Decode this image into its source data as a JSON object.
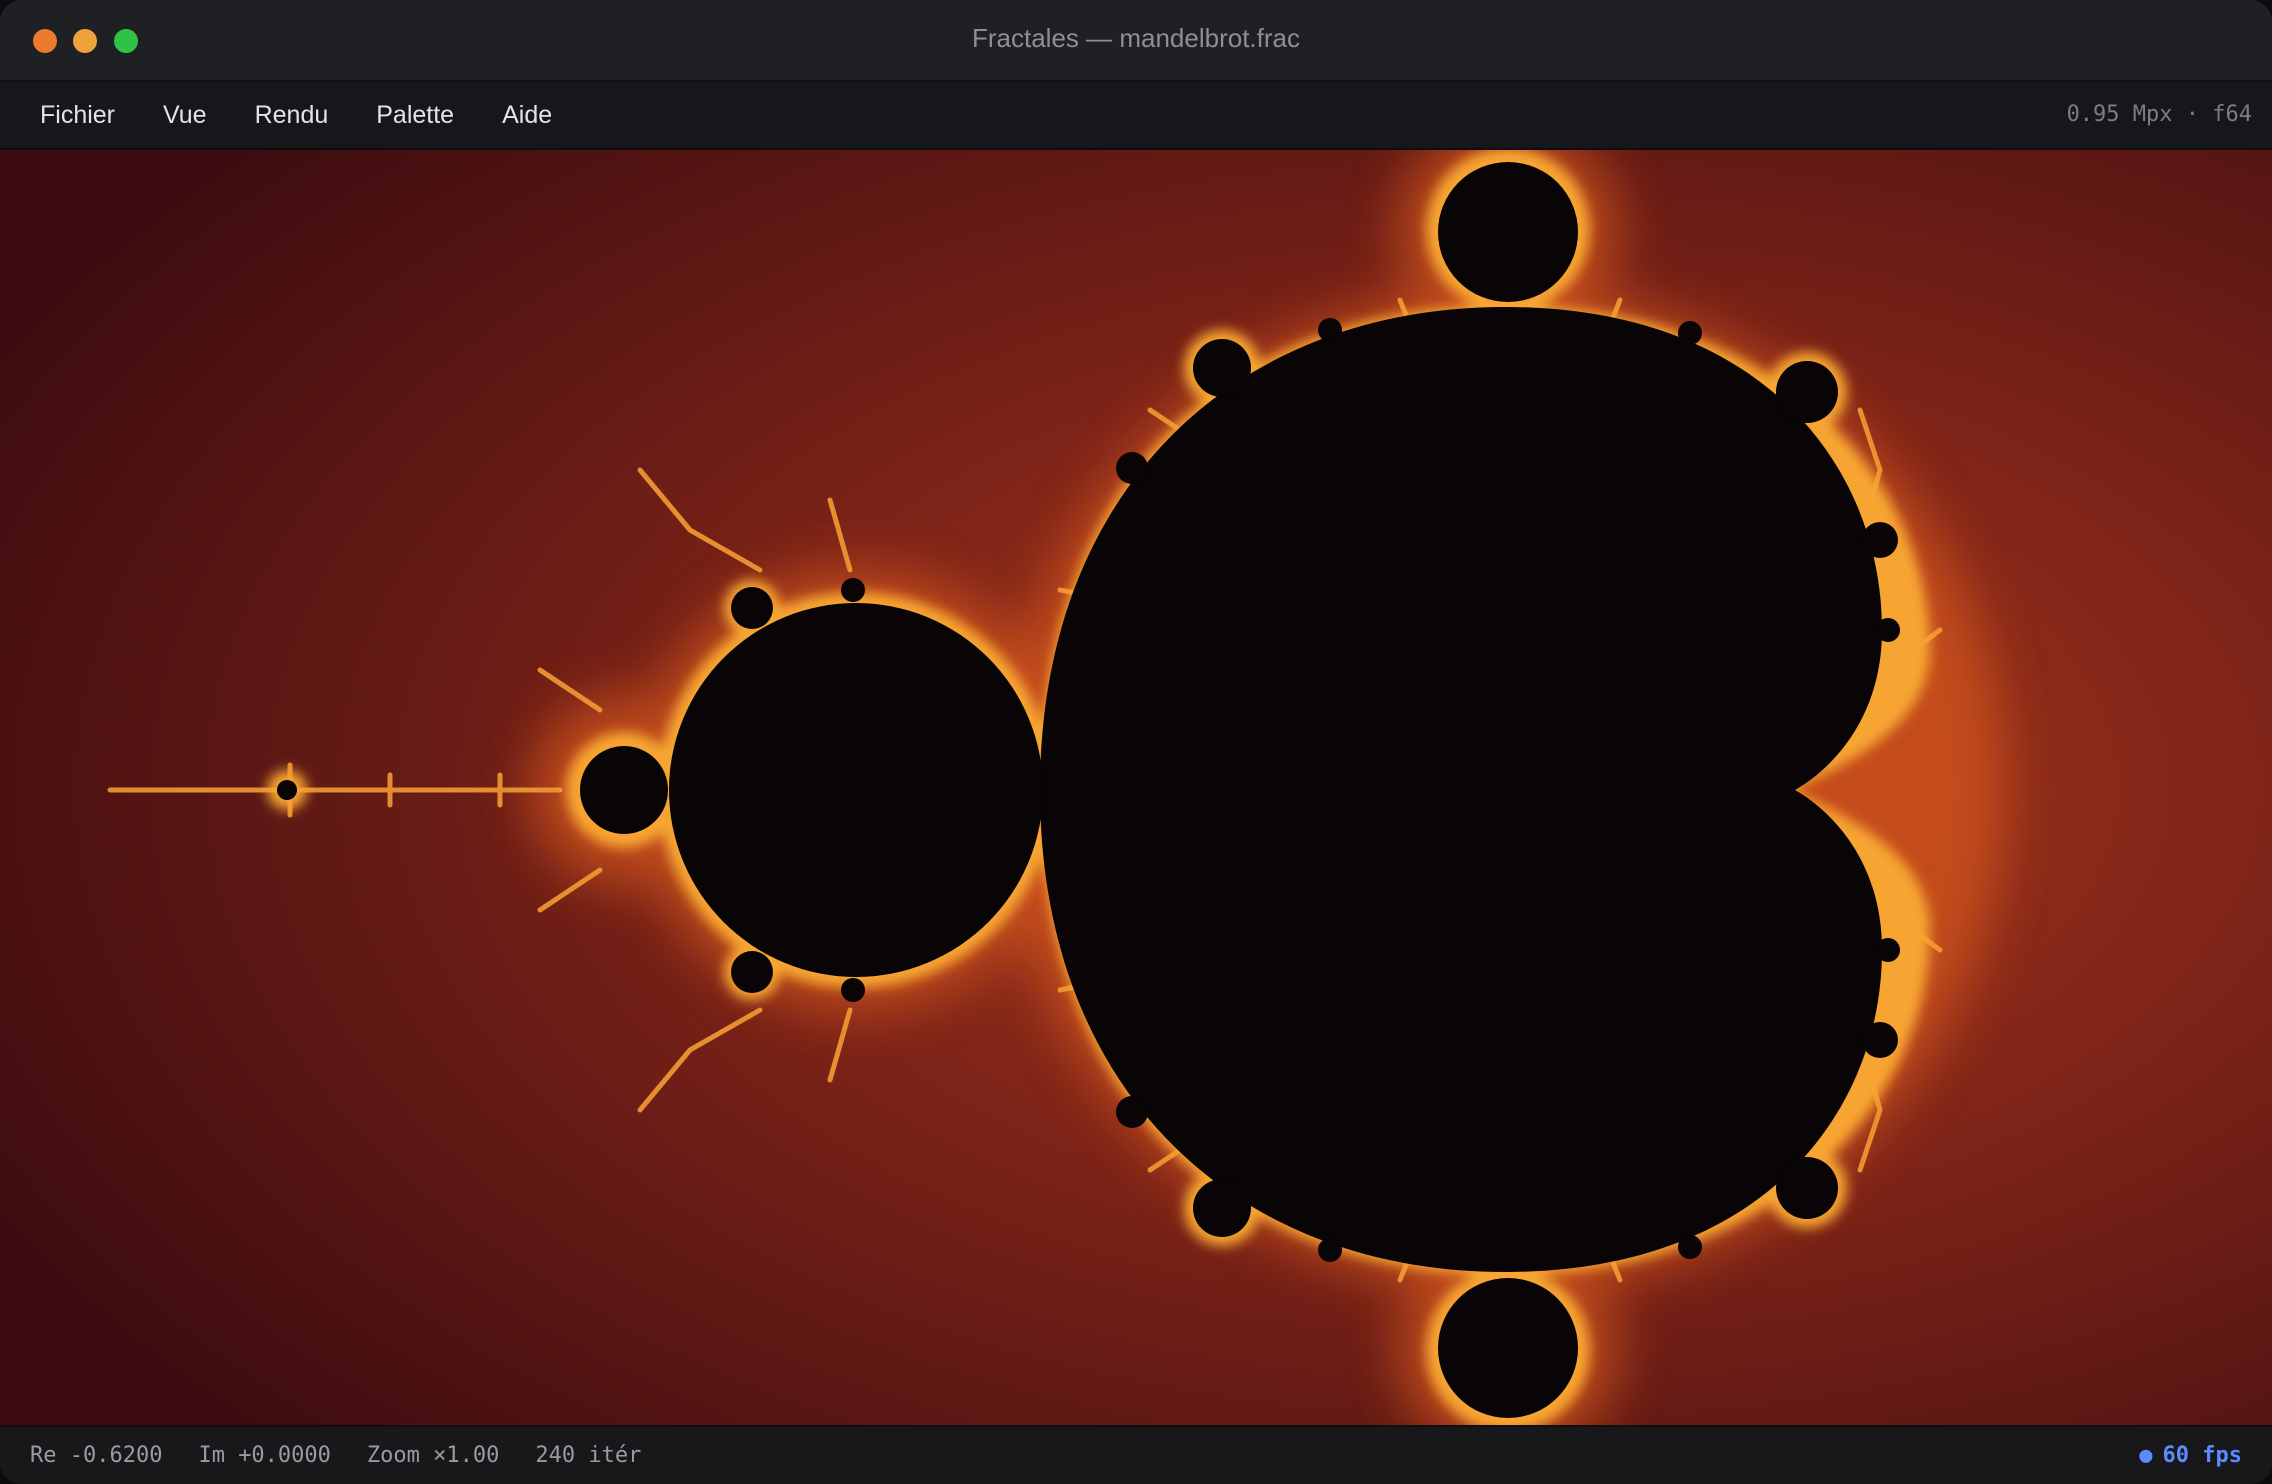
{
  "window": {
    "title": "Fractales — mandelbrot.frac"
  },
  "menu": {
    "items": [
      "Fichier",
      "Vue",
      "Rendu",
      "Palette",
      "Aide"
    ],
    "info": "0.95 Mpx · f64"
  },
  "status": {
    "re": "Re -0.6200",
    "im": "Im +0.0000",
    "zoom": "Zoom ×1.00",
    "iterations": "240 itér",
    "fps_dot": "●",
    "fps": "60 fps"
  },
  "colors": {
    "background_outer": "#4a1010",
    "background_inner": "#8a2a18",
    "glow": "#d9621a",
    "fringe": "#f6a733",
    "set": "#0a0506",
    "fps_accent": "#5a8cff"
  }
}
